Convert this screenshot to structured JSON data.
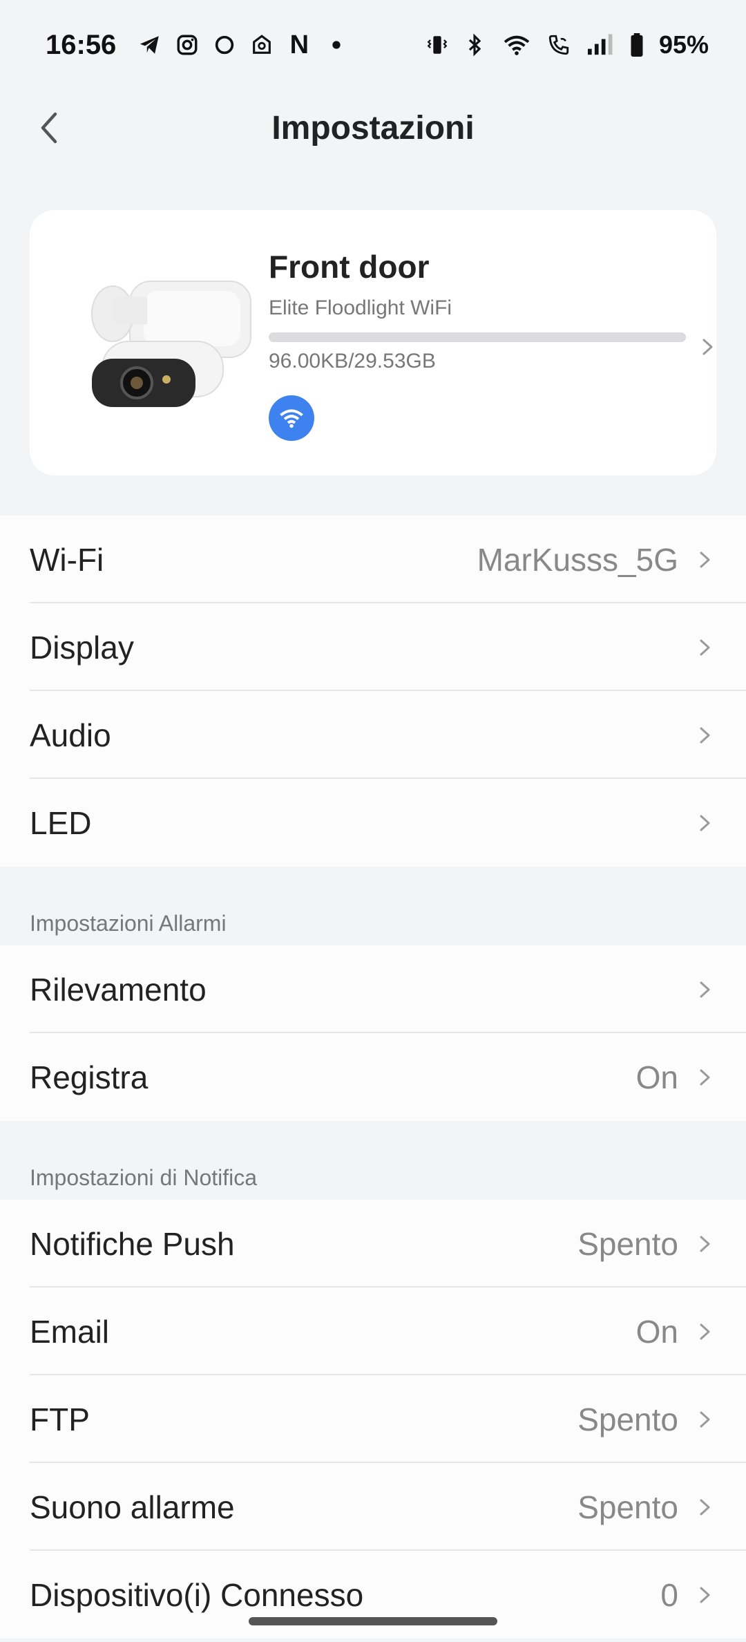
{
  "status_bar": {
    "time": "16:56",
    "left_icons": [
      "telegram-icon",
      "instagram-icon",
      "threads-icon",
      "app-icon",
      "n-app-icon",
      "dot-icon"
    ],
    "right_icons": [
      "vibrate-icon",
      "bluetooth-icon",
      "wifi-icon",
      "wifi-call-icon",
      "signal-icon",
      "battery-icon"
    ],
    "n_label": "N",
    "battery": "95%"
  },
  "header": {
    "title": "Impostazioni"
  },
  "device": {
    "name": "Front door",
    "model": "Elite Floodlight WiFi",
    "storage": "96.00KB/29.53GB",
    "storage_fraction": 0.0,
    "connection_icon": "wifi-icon"
  },
  "general": {
    "items": [
      {
        "label": "Wi-Fi",
        "value": "MarKusss_5G"
      },
      {
        "label": "Display",
        "value": ""
      },
      {
        "label": "Audio",
        "value": ""
      },
      {
        "label": "LED",
        "value": ""
      }
    ]
  },
  "alarm": {
    "header": "Impostazioni Allarmi",
    "items": [
      {
        "label": "Rilevamento",
        "value": ""
      },
      {
        "label": "Registra",
        "value": "On"
      }
    ]
  },
  "notify": {
    "header": "Impostazioni di Notifica",
    "items": [
      {
        "label": "Notifiche Push",
        "value": "Spento"
      },
      {
        "label": "Email",
        "value": "On"
      },
      {
        "label": "FTP",
        "value": "Spento"
      },
      {
        "label": "Suono allarme",
        "value": "Spento"
      },
      {
        "label": "Dispositivo(i) Connesso",
        "value": "0"
      }
    ]
  },
  "colors": {
    "accent": "#3d82ee",
    "background": "#f3f4f6"
  }
}
